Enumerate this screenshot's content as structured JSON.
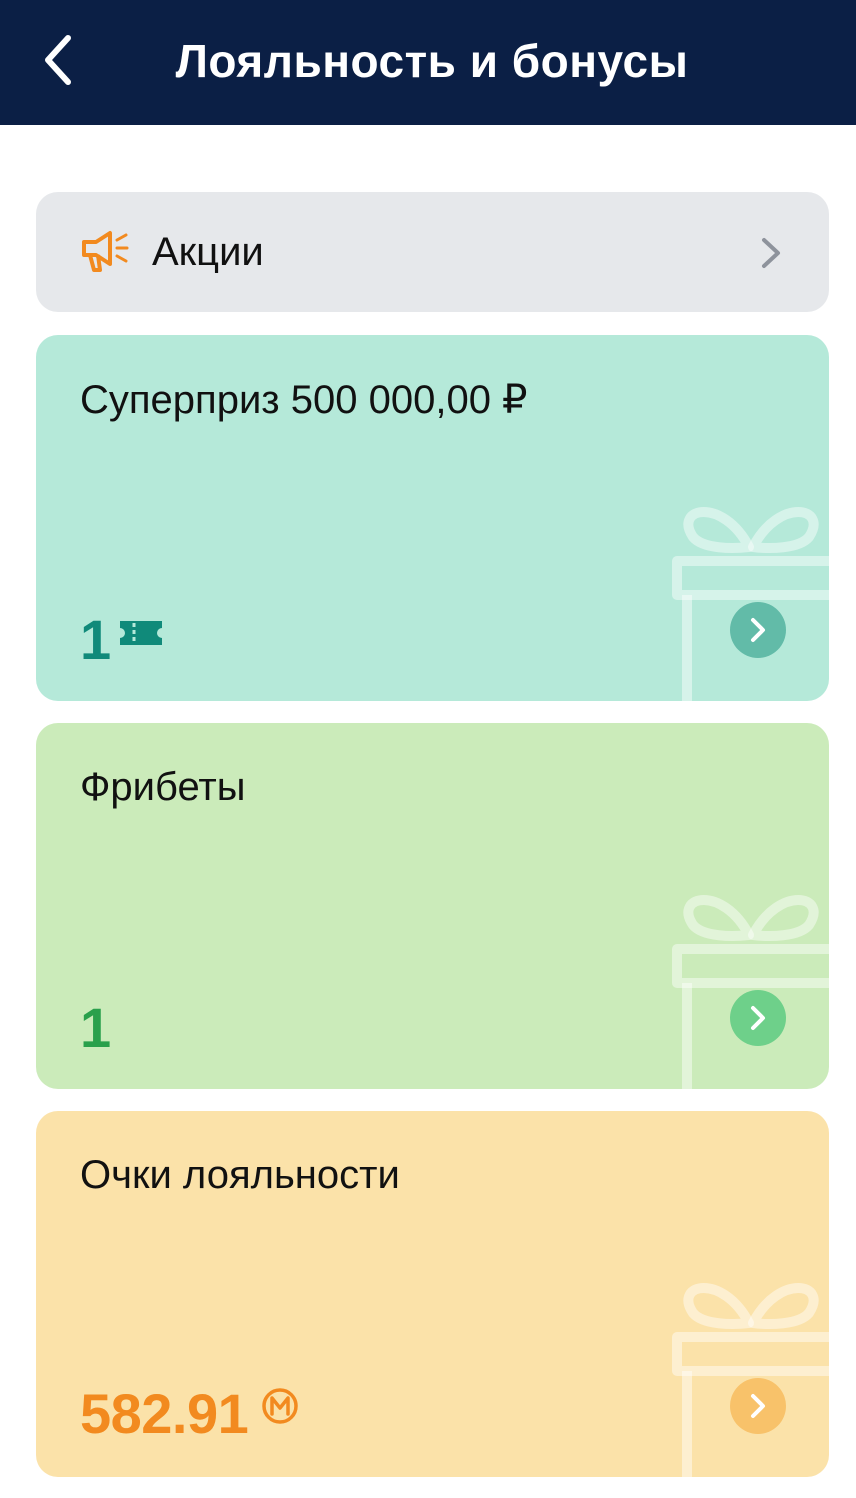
{
  "header": {
    "title": "Лояльность и бонусы",
    "background": "#0b1f45"
  },
  "promo": {
    "label": "Акции",
    "icon": "megaphone-icon",
    "icon_color": "#f28a1f"
  },
  "cards": [
    {
      "title": "Суперприз 500 000,00 ₽",
      "count": "1",
      "icon": "ticket-icon",
      "color": "#b5e9d9",
      "accent": "#108a7a"
    },
    {
      "title": "Фрибеты",
      "count": "1",
      "color": "#cbebba",
      "accent": "#2aa04c"
    },
    {
      "title": "Очки лояльности",
      "count": "582.91",
      "icon": "m-points-icon",
      "color": "#fbe2a9",
      "accent": "#f28a1f"
    }
  ]
}
